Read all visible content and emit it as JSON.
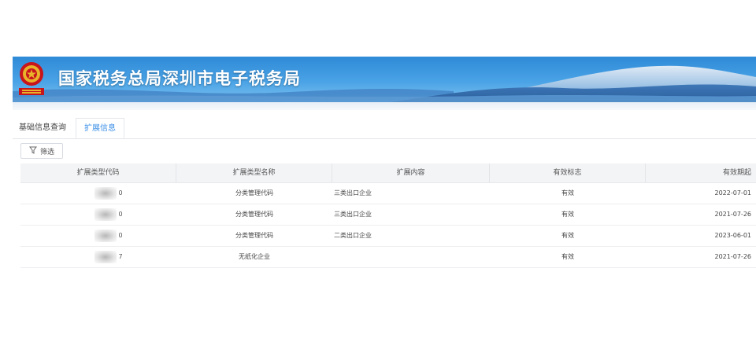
{
  "header": {
    "title": "国家税务总局深圳市电子税务局",
    "brand_color": "#2f8ad7"
  },
  "tabs": [
    {
      "label": "基础信息查询",
      "active": false
    },
    {
      "label": "扩展信息",
      "active": true
    }
  ],
  "filter": {
    "label": "筛选",
    "icon": "filter-icon"
  },
  "table": {
    "columns": [
      "扩展类型代码",
      "扩展类型名称",
      "扩展内容",
      "有效标志",
      "有效期起"
    ],
    "rows": [
      {
        "code_suffix": "0",
        "type_name": "分类管理代码",
        "content": "三类出口企业",
        "flag": "有效",
        "start": "2022-07-01"
      },
      {
        "code_suffix": "0",
        "type_name": "分类管理代码",
        "content": "三类出口企业",
        "flag": "有效",
        "start": "2021-07-26"
      },
      {
        "code_suffix": "0",
        "type_name": "分类管理代码",
        "content": "二类出口企业",
        "flag": "有效",
        "start": "2023-06-01"
      },
      {
        "code_suffix": "7",
        "type_name": "无纸化企业",
        "content": "",
        "flag": "有效",
        "start": "2021-07-26"
      }
    ]
  }
}
